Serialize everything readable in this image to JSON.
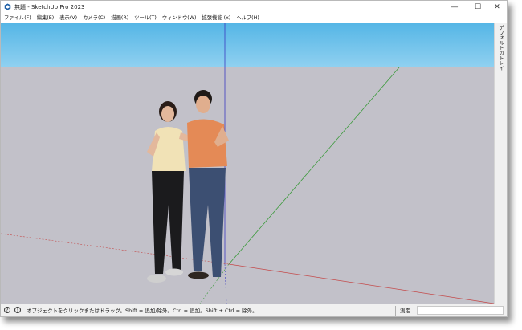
{
  "window": {
    "title": "無題 - SketchUp Pro 2023",
    "controls": {
      "minimize": "—",
      "maximize": "☐",
      "close": "✕"
    }
  },
  "menubar": {
    "items": [
      "ファイル(F)",
      "編集(E)",
      "表示(V)",
      "カメラ(C)",
      "描画(R)",
      "ツール(T)",
      "ウィンドウ(W)",
      "拡張機能 (x)",
      "ヘルプ(H)"
    ]
  },
  "tray": {
    "label": "デフォルトのトレイ"
  },
  "statusbar": {
    "message": "オブジェクトをクリックまたはドラッグ。Shift = 追加/除外。Ctrl = 追加。Shift + Ctrl = 除外。",
    "measurements_label": "測定",
    "measurements_value": ""
  },
  "colors": {
    "sky_top": "#55b6e6",
    "ground": "#c2c1c9",
    "axis_red": "#c44a4a",
    "axis_green": "#3a9a3a",
    "axis_blue": "#3a3ac0"
  },
  "icons": {
    "app": "sketchup-logo-icon",
    "status_left": "help-icon",
    "status_right": "info-icon"
  }
}
